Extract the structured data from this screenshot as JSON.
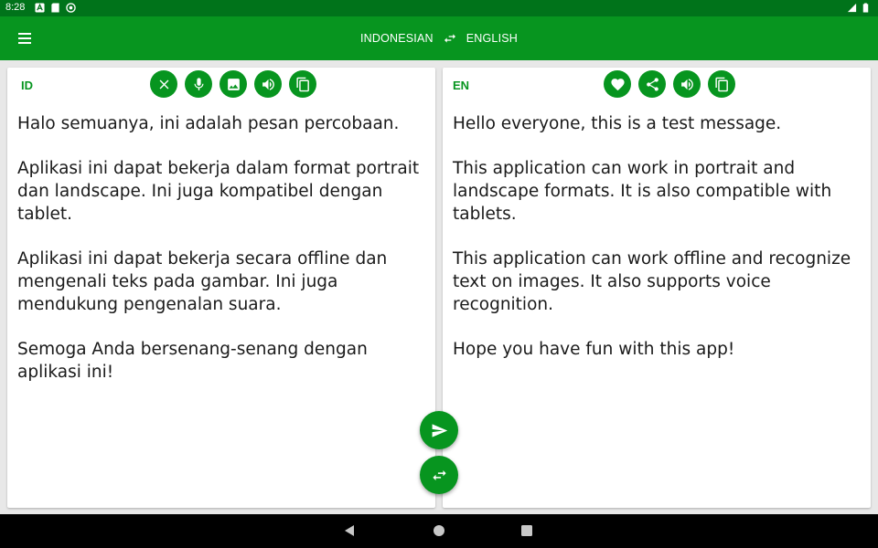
{
  "status_bar": {
    "time": "8:28"
  },
  "app_bar": {
    "source_language": "INDONESIAN",
    "target_language": "ENGLISH"
  },
  "source_panel": {
    "code": "ID",
    "toolbar": [
      "clear-icon",
      "mic-icon",
      "image-icon",
      "speaker-icon",
      "copy-icon"
    ],
    "text": "Halo semuanya, ini adalah pesan percobaan.\n\nAplikasi ini dapat bekerja dalam format portrait dan landscape. Ini juga kompatibel dengan tablet.\n\nAplikasi ini dapat bekerja secara offline dan mengenali teks pada gambar. Ini juga mendukung pengenalan suara.\n\nSemoga Anda bersenang-senang dengan aplikasi ini!"
  },
  "target_panel": {
    "code": "EN",
    "toolbar": [
      "favorite-icon",
      "share-icon",
      "speaker-icon",
      "copy-icon"
    ],
    "text": "Hello everyone, this is a test message.\n\nThis application can work in portrait and landscape formats. It is also compatible with tablets.\n\nThis application can work offline and recognize text on images. It also supports voice recognition.\n\nHope you have fun with this app!"
  },
  "fabs": [
    "send-icon",
    "swap-icon"
  ],
  "colors": {
    "primary": "#07951f",
    "status_bar": "#00731a",
    "nav_bar": "#000000",
    "panel_bg": "#ffffff",
    "app_bg": "#e8e8e8"
  }
}
